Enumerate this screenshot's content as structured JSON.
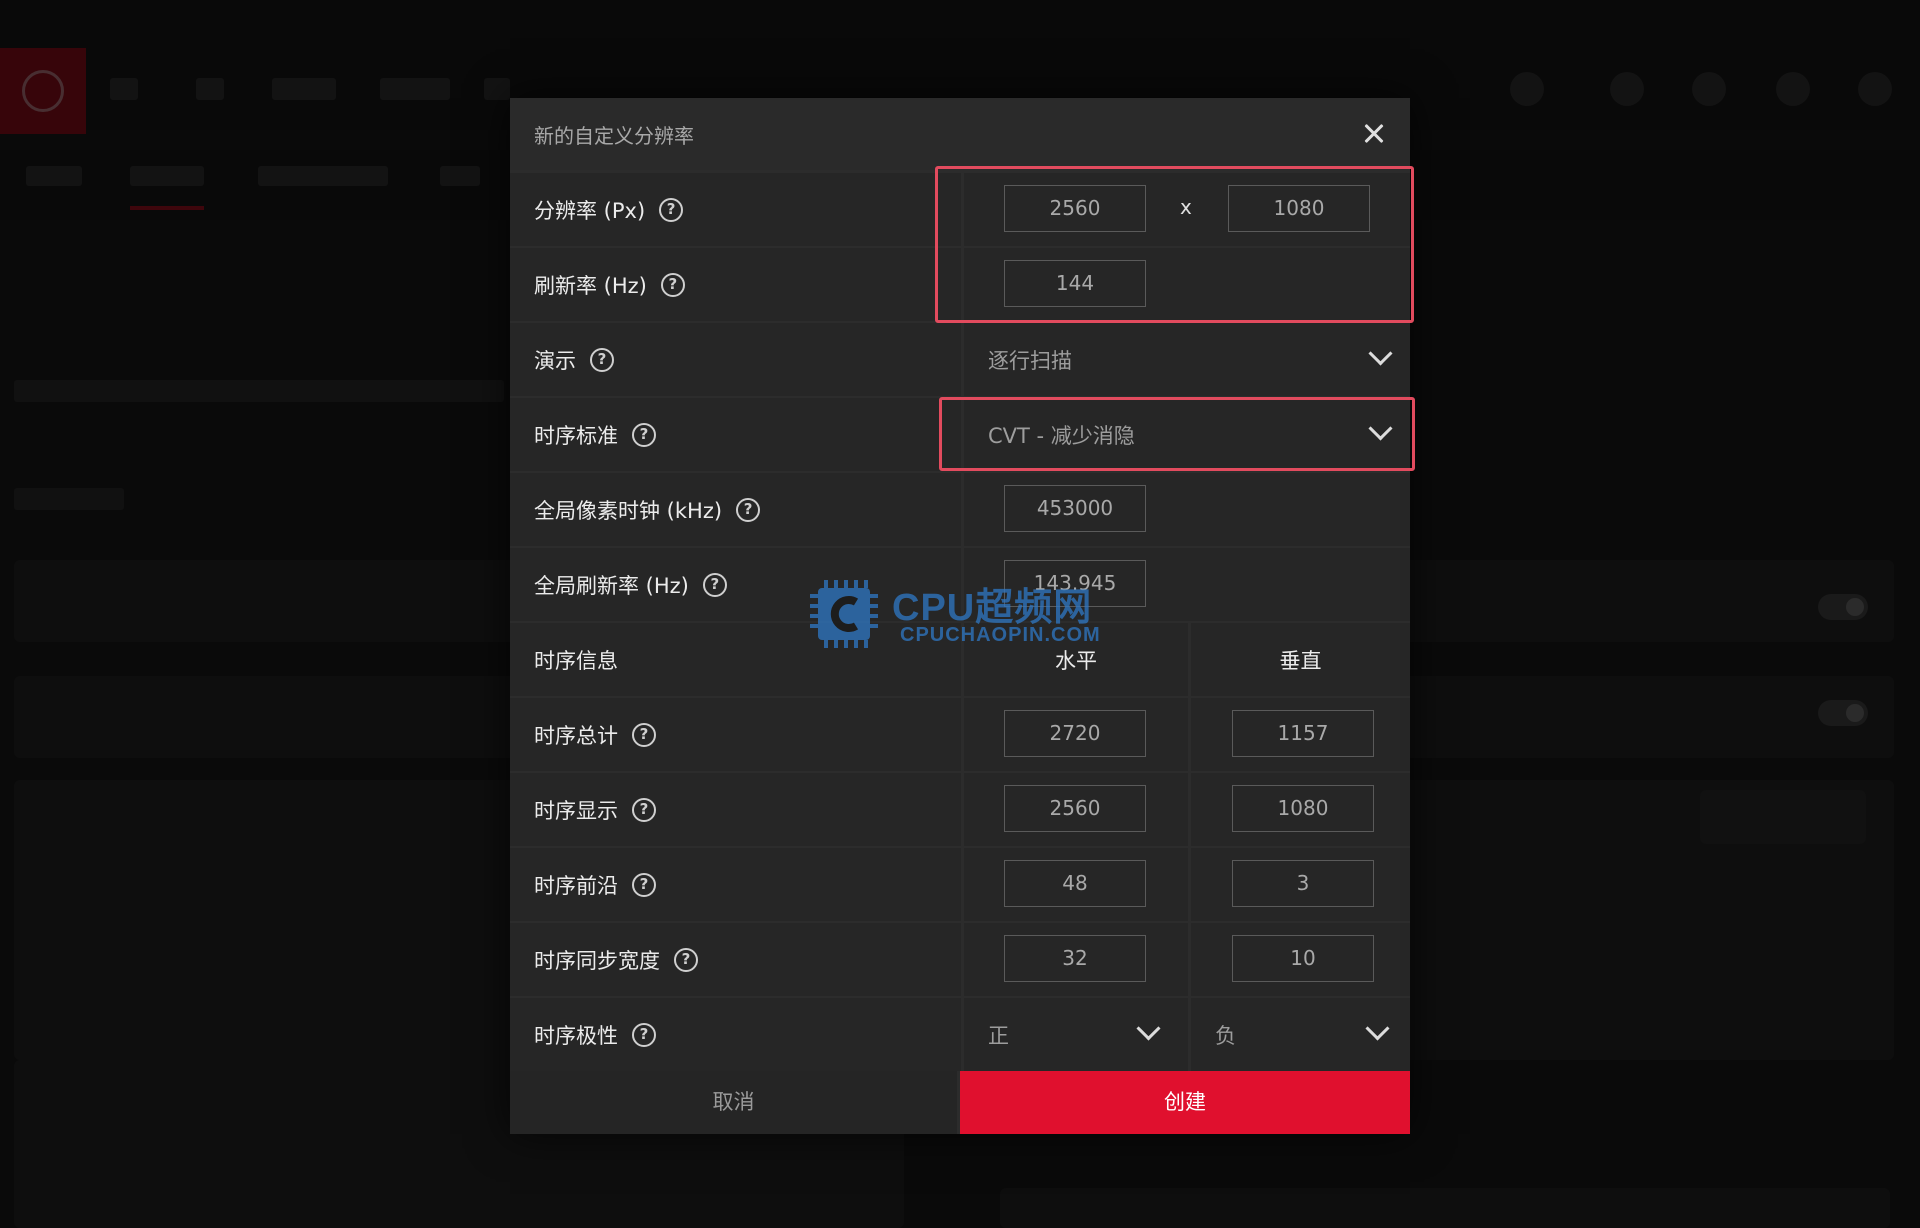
{
  "dialog": {
    "title": "新的自定义分辨率",
    "resolution": {
      "label": "分辨率 (Px)",
      "width": "2560",
      "separator": "x",
      "height": "1080"
    },
    "refresh_rate": {
      "label": "刷新率 (Hz)",
      "value": "144"
    },
    "presentation": {
      "label": "演示",
      "selected": "逐行扫描"
    },
    "timing_standard": {
      "label": "时序标准",
      "selected": "CVT - 减少消隐"
    },
    "pixel_clock": {
      "label": "全局像素时钟 (kHz)",
      "value": "453000"
    },
    "global_refresh": {
      "label": "全局刷新率 (Hz)",
      "value": "143.945"
    },
    "timing_info": {
      "label": "时序信息",
      "horizontal": "水平",
      "vertical": "垂直"
    },
    "timing_total": {
      "label": "时序总计",
      "h": "2720",
      "v": "1157"
    },
    "timing_display": {
      "label": "时序显示",
      "h": "2560",
      "v": "1080"
    },
    "timing_front_porch": {
      "label": "时序前沿",
      "h": "48",
      "v": "3"
    },
    "timing_sync_width": {
      "label": "时序同步宽度",
      "h": "32",
      "v": "10"
    },
    "timing_polarity": {
      "label": "时序极性",
      "h": "正",
      "v": "负"
    },
    "help_glyph": "?",
    "cancel_label": "取消",
    "create_label": "创建"
  },
  "icons": {
    "close": "close-icon",
    "help": "help-circle-icon",
    "dropdown": "chevron-down-icon"
  },
  "watermark": {
    "main": "CPU超频网",
    "sub": "CPUCHAOPIN.COM"
  },
  "colors": {
    "accent": "#e0102e",
    "highlight": "#e24b5e",
    "dialog_bg": "#2c2c2c",
    "watermark": "#2f78c5"
  }
}
